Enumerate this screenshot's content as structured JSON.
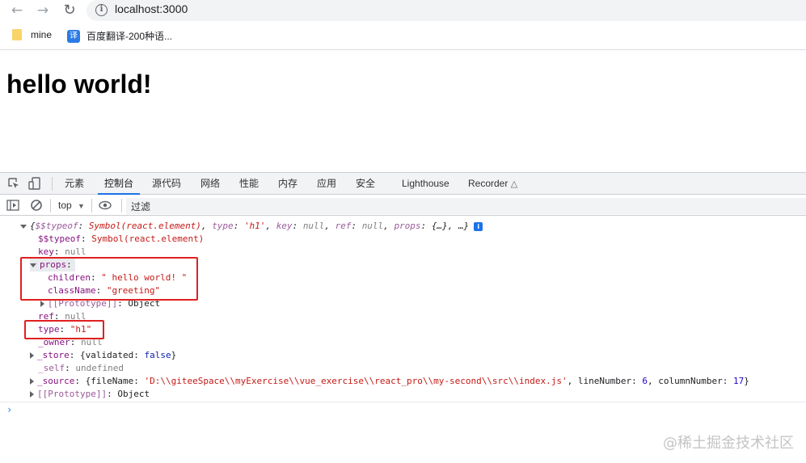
{
  "browser": {
    "url": "localhost:3000",
    "bookmarks": [
      {
        "label": "mine",
        "icon": "folder-icon"
      },
      {
        "label": "百度翻译-200种语...",
        "icon": "baidu-translate-icon",
        "badge": "译"
      }
    ]
  },
  "page": {
    "heading": "hello world!"
  },
  "devtools": {
    "tabs": [
      "元素",
      "控制台",
      "源代码",
      "网络",
      "性能",
      "内存",
      "应用",
      "安全",
      "Lighthouse",
      "Recorder"
    ],
    "active_tab": "控制台",
    "context": "top",
    "filter_placeholder": "过滤",
    "console": {
      "summary": "{$$typeof: Symbol(react.element), type: 'h1', key: null, ref: null, props: {…}, …}",
      "summary_parts": {
        "open": "{",
        "k1": "$$typeof",
        "v1": "Symbol(react.element)",
        "k2": "type",
        "v2": "'h1'",
        "k3": "key",
        "v3": "null",
        "k4": "ref",
        "v4": "null",
        "k5": "props",
        "v5": "{…}",
        "tail": "…}"
      },
      "rows": {
        "typeof_key": "$$typeof",
        "typeof_val": "Symbol(react.element)",
        "key_key": "key",
        "key_val": "null",
        "props_key": "props",
        "children_key": "children",
        "children_val": "\" hello world! \"",
        "classname_key": "className",
        "classname_val": "\"greeting\"",
        "proto_key": "[[Prototype]]",
        "proto_val": "Object",
        "ref_key": "ref",
        "ref_val": "null",
        "type_key": "type",
        "type_val": "\"h1\"",
        "owner_key": "_owner",
        "owner_val": "null",
        "store_key": "_store",
        "store_val_open": "{validated: ",
        "store_val_bool": "false",
        "store_val_close": "}",
        "self_key": "_self",
        "self_val": "undefined",
        "source_key": "_source",
        "source_filename_label": "{fileName: ",
        "source_filename": "'D:\\\\giteeSpace\\\\myExercise\\\\vue_exercise\\\\react_pro\\\\my-second\\\\src\\\\index.js'",
        "source_line_label": ", lineNumber: ",
        "source_line": "6",
        "source_col_label": ", columnNumber: ",
        "source_col": "17",
        "source_close": "}",
        "proto2_key": "[[Prototype]]",
        "proto2_val": "Object"
      }
    }
  },
  "watermark": "@稀土掘金技术社区",
  "colors": {
    "highlight_box": "#e02020",
    "active_tab_underline": "#1a73e8"
  }
}
